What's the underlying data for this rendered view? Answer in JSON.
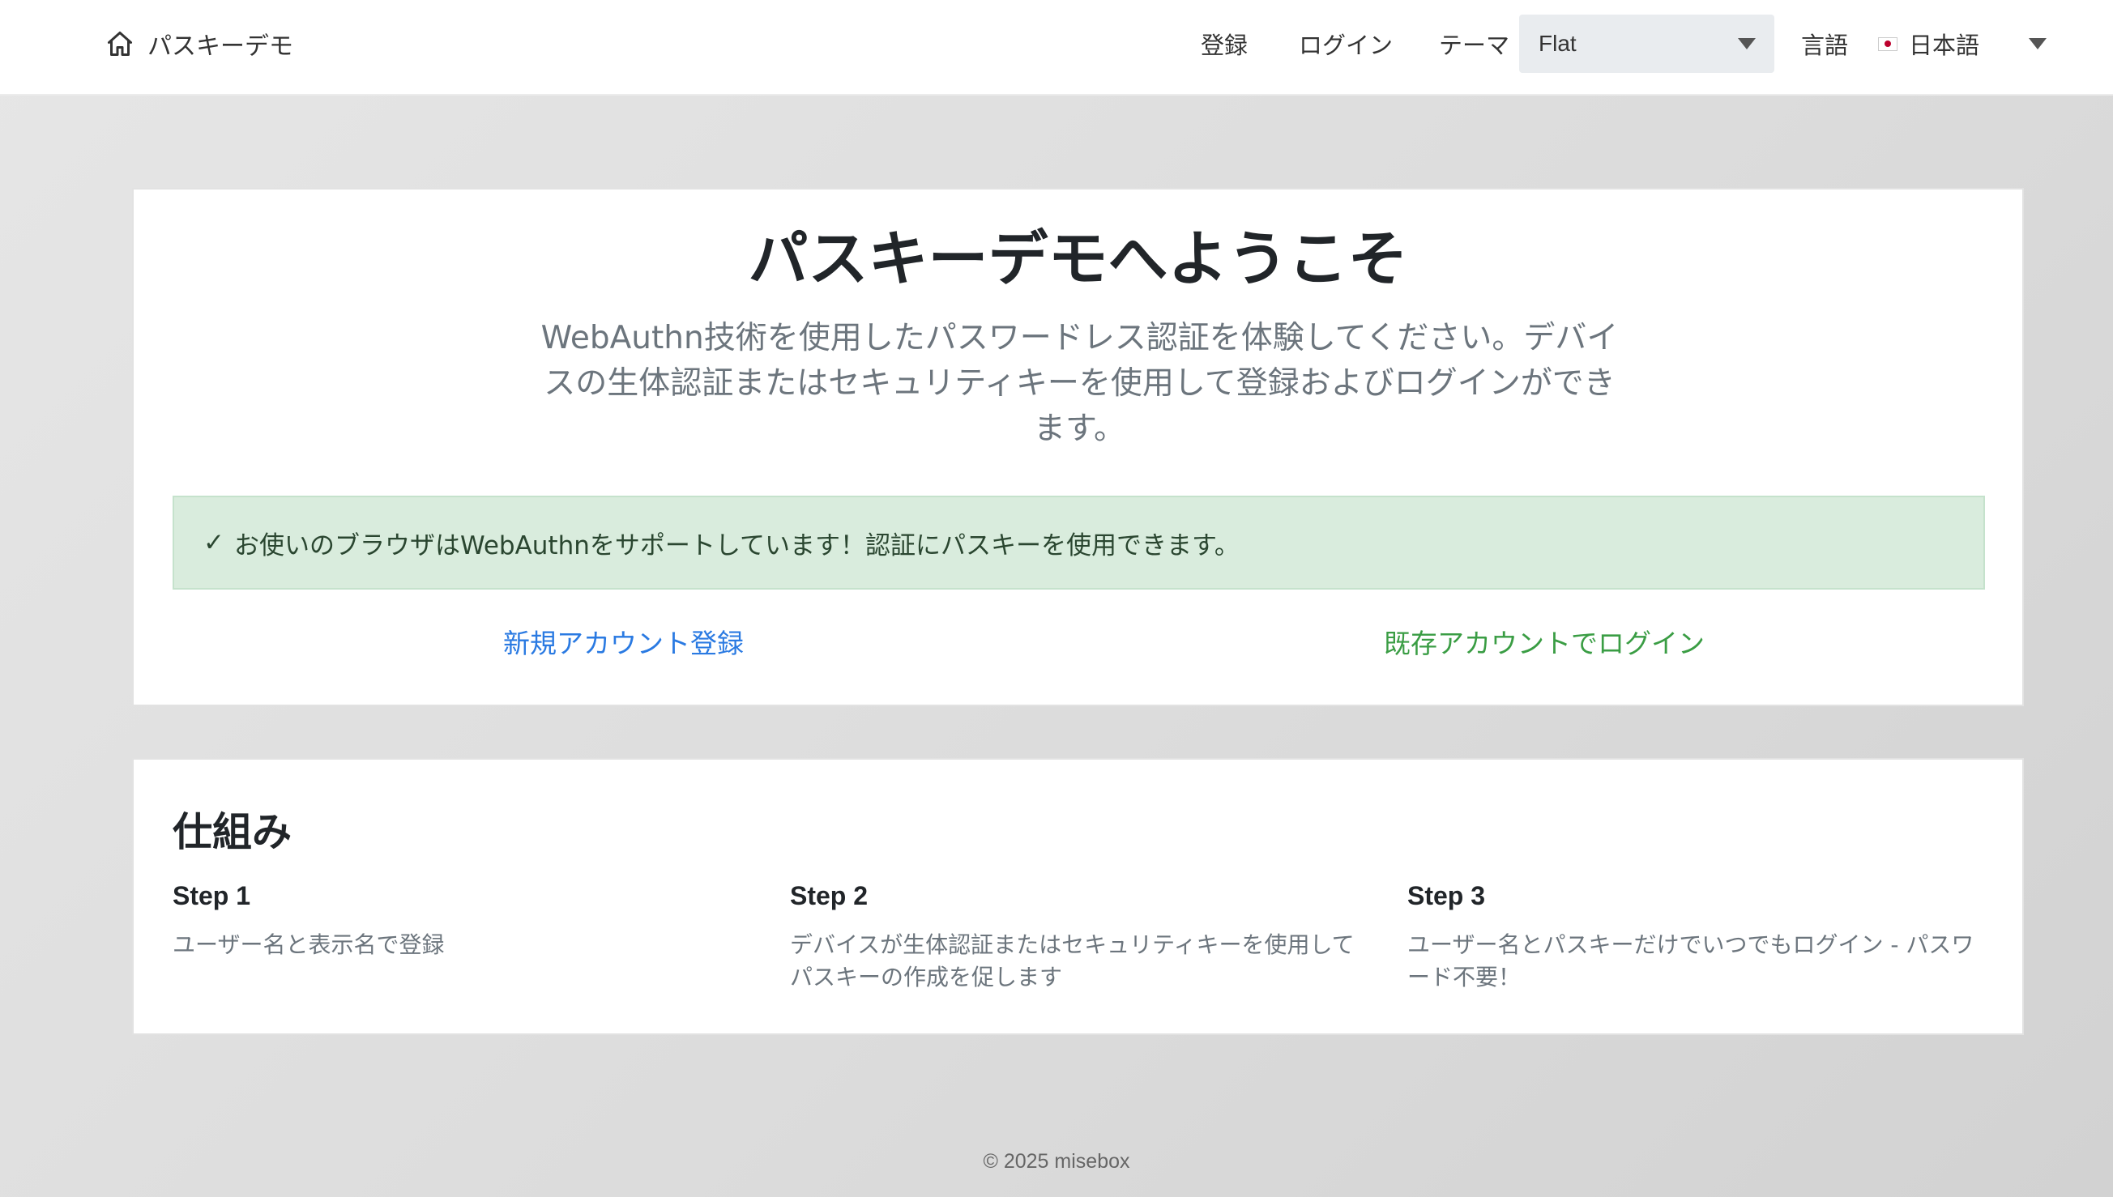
{
  "navbar": {
    "brand_text": "パスキーデモ",
    "register_label": "登録",
    "login_label": "ログイン",
    "theme_label": "テーマ",
    "theme_value": "Flat",
    "language_label": "言語",
    "language_value": "日本語"
  },
  "welcome": {
    "title": "パスキーデモへようこそ",
    "lead": "WebAuthn技術を使用したパスワードレス認証を体験してください。デバイスの生体認証またはセキュリティキーを使用して登録およびログインができます。",
    "alert_check": "✓",
    "alert_text": "お使いのブラウザはWebAuthnをサポートしています！認証にパスキーを使用できます。",
    "register_link": "新規アカウント登録",
    "login_link": "既存アカウントでログイン"
  },
  "how_it_works": {
    "title": "仕組み",
    "steps": [
      {
        "title": "Step 1",
        "description": "ユーザー名と表示名で登録"
      },
      {
        "title": "Step 2",
        "description": "デバイスが生体認証またはセキュリティキーを使用してパスキーの作成を促します"
      },
      {
        "title": "Step 3",
        "description": "ユーザー名とパスキーだけでいつでもログイン - パスワード不要！"
      }
    ]
  },
  "footer": {
    "copyright": "© 2025 misebox"
  },
  "colors": {
    "link_blue": "#2a7ae2",
    "link_green": "#3a9d44",
    "alert_bg": "#d9ecdd",
    "muted_text": "#6c757d"
  },
  "icons": {
    "brand": "home-icon",
    "theme_dropdown": "caret-down-icon",
    "language_flag": "japan-flag-icon",
    "language_dropdown": "caret-down-icon",
    "alert": "check-icon"
  }
}
